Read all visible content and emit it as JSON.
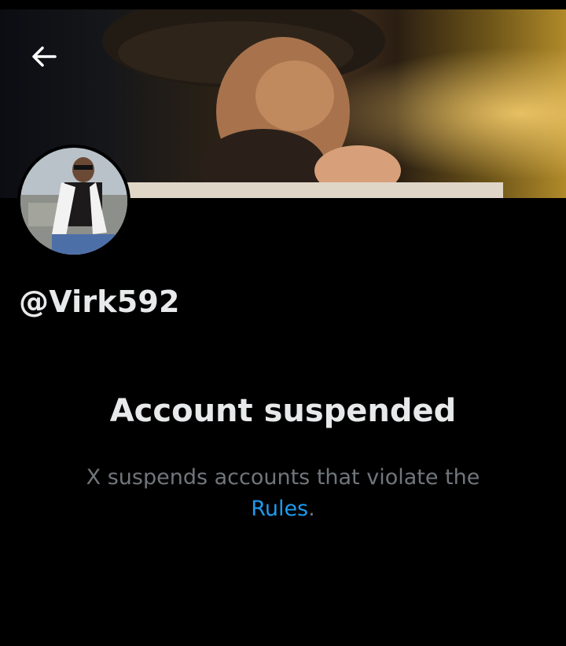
{
  "profile": {
    "handle": "@Virk592"
  },
  "header": {
    "back_icon": "arrow-left-icon"
  },
  "suspension": {
    "title": "Account suspended",
    "message_line1": "X suspends accounts that violate the",
    "rules_link": "Rules",
    "period": "."
  },
  "colors": {
    "background": "#000000",
    "text_primary": "#e7e9ea",
    "text_secondary": "#71767b",
    "link": "#1d9bf0"
  }
}
